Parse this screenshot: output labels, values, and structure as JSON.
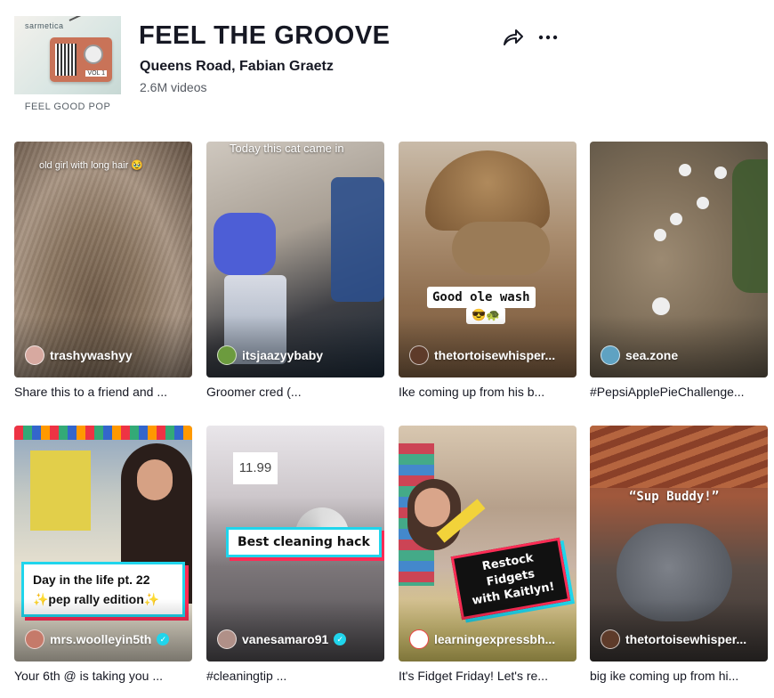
{
  "playlist": {
    "title": "FEEL THE GROOVE",
    "artists": "Queens Road, Fabian Graetz",
    "video_count": "2.6M videos",
    "cover_caption": "FEEL GOOD POP",
    "cover_label": "sarmetica",
    "cover_vol": "VOL 1"
  },
  "actions": {
    "share_icon": "share-arrow-icon",
    "more_icon": "more-dots-icon"
  },
  "videos": [
    {
      "author": "trashywashyy",
      "caption": "Share this to a friend and ...",
      "overlay": "old girl with long hair 🥹",
      "verified": false
    },
    {
      "author": "itsjaazyybaby",
      "caption": "Groomer cred (...",
      "overlay": "Today this cat came in",
      "verified": false
    },
    {
      "author": "thetortoisewhisper...",
      "caption": "Ike coming up from his b...",
      "overlay": "Good ole wash",
      "overlay2": "😎🐢",
      "verified": false
    },
    {
      "author": "sea.zone",
      "caption": "#PepsiApplePieChallenge...",
      "verified": false
    },
    {
      "author": "mrs.woolleyin5th",
      "caption": "Your 6th @ is taking you ...",
      "overlay": "Day in the life pt. 22",
      "overlay2": "✨pep rally edition✨",
      "verified": true
    },
    {
      "author": "vanesamaro91",
      "caption": "#cleaningtip ...",
      "overlay": "Best cleaning hack",
      "price": "11.99",
      "verified": true
    },
    {
      "author": "learningexpressbh...",
      "caption": "It's Fidget Friday! Let's re...",
      "overlay": "Restock Fidgets",
      "overlay2": "with Kaitlyn!",
      "verified": false
    },
    {
      "author": "thetortoisewhisper...",
      "caption": "big ike coming up from hi...",
      "overlay": "“Sup Buddy!”",
      "verified": false
    }
  ]
}
